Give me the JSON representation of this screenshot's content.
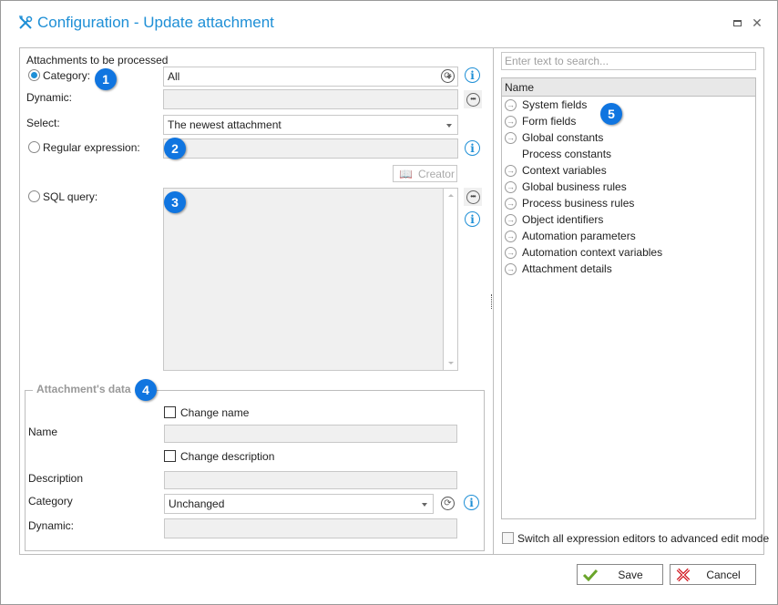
{
  "window": {
    "title": "Configuration - Update attachment",
    "icons": {
      "title": "tools-icon",
      "maximize": "maximize-icon",
      "close": "close-icon"
    }
  },
  "colors": {
    "accent": "#1e8fd6",
    "badge": "#1075e0",
    "save_check": "#6aa52b",
    "cancel_x": "#d0121b"
  },
  "left": {
    "section_label": "Attachments to be processed",
    "category": {
      "label": "Category:",
      "selected": true,
      "value": "All"
    },
    "dynamic": {
      "label": "Dynamic:",
      "value": ""
    },
    "select": {
      "label": "Select:",
      "value": "The newest attachment"
    },
    "regex": {
      "label": "Regular expression:",
      "selected": false,
      "value": ""
    },
    "creator_label": "Creator",
    "sql": {
      "label": "SQL query:",
      "selected": false,
      "value": ""
    },
    "badges": [
      "1",
      "2",
      "3",
      "4"
    ],
    "group": {
      "title": "Attachment's data",
      "change_name": {
        "label": "Change name",
        "checked": false
      },
      "name": {
        "label": "Name",
        "value": ""
      },
      "change_description": {
        "label": "Change description",
        "checked": false
      },
      "description": {
        "label": "Description",
        "value": ""
      },
      "category": {
        "label": "Category",
        "value": "Unchanged"
      },
      "dynamic": {
        "label": "Dynamic:",
        "value": ""
      }
    }
  },
  "right": {
    "search_placeholder": "Enter text to search...",
    "column_header": "Name",
    "badge": "5",
    "items": [
      {
        "label": "System fields",
        "expandable": true
      },
      {
        "label": "Form fields",
        "expandable": true
      },
      {
        "label": "Global constants",
        "expandable": true
      },
      {
        "label": "Process constants",
        "expandable": false
      },
      {
        "label": "Context variables",
        "expandable": true
      },
      {
        "label": "Global business rules",
        "expandable": true
      },
      {
        "label": "Process business rules",
        "expandable": true
      },
      {
        "label": "Object identifiers",
        "expandable": true
      },
      {
        "label": "Automation parameters",
        "expandable": true
      },
      {
        "label": "Automation context variables",
        "expandable": true
      },
      {
        "label": "Attachment details",
        "expandable": true
      }
    ],
    "advanced_mode": {
      "label": "Switch all expression editors to advanced edit mode",
      "checked": false
    }
  },
  "footer": {
    "save_label": "Save",
    "cancel_label": "Cancel"
  }
}
